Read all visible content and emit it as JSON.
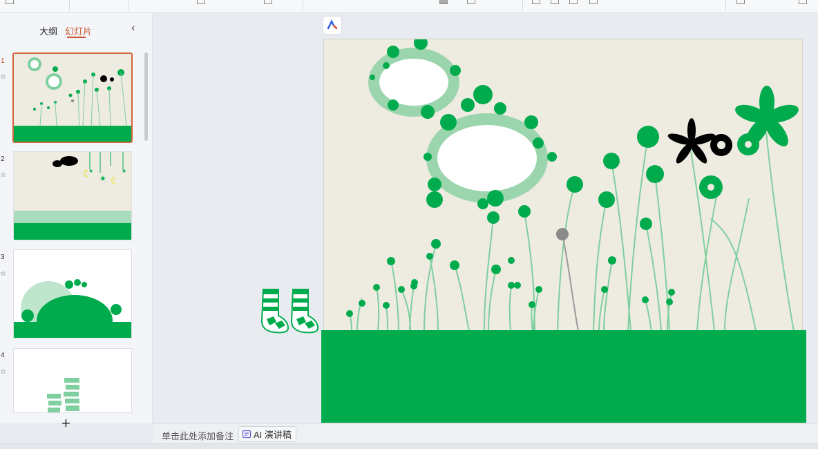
{
  "sidebar": {
    "tabs": [
      {
        "label": "大纲"
      },
      {
        "label": "幻灯片"
      }
    ],
    "slides": [
      {
        "num": "1"
      },
      {
        "num": "2"
      },
      {
        "num": "3"
      },
      {
        "num": "4"
      }
    ],
    "add_label": "+"
  },
  "notes": {
    "placeholder": "单击此处添加备注",
    "ai_button_label": "AI 演讲稿"
  },
  "colors": {
    "accent": "#c9542c",
    "slide_green": "#00ab4e",
    "slide_bg": "#eeebe1"
  }
}
